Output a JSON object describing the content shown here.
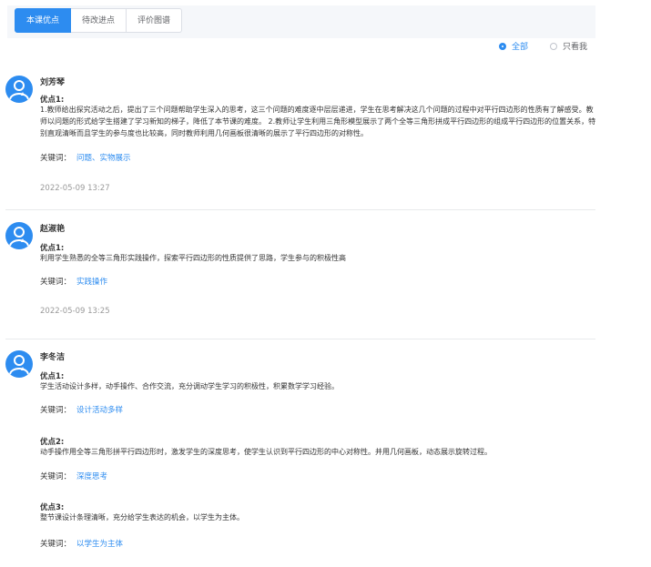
{
  "tabs": [
    "本课优点",
    "待改进点",
    "评价图谱"
  ],
  "filters": {
    "all": "全部",
    "mine": "只看我"
  },
  "comments": [
    {
      "name": "刘芳琴",
      "points": [
        {
          "title": "优点1:",
          "text": "1.教师给出探究活动之后，提出了三个问题帮助学生深入的思考，这三个问题的难度逐中层层递进，学生在思考解决这几个问题的过程中对平行四边形的性质有了解感受。教师以问题的形式给学生搭建了学习新知的梯子，降低了本节课的难度。 2.教师让学生利用三角形模型展示了两个全等三角形拼成平行四边形的组成平行四边形的位置关系，特别直观清晰而且学生的参与度也比较高，同时教师利用几何画板很清晰的展示了平行四边形的对称性。",
          "keyword_label": "关键词：",
          "keywords": "问题、实物展示"
        }
      ],
      "time": "2022-05-09 13:27"
    },
    {
      "name": "赵淑艳",
      "points": [
        {
          "title": "优点1:",
          "text": "利用学生熟悉的全等三角形实践操作，探索平行四边形的性质提供了思路，学生参与的积极性高",
          "keyword_label": "关键词：",
          "keywords": "实践操作"
        }
      ],
      "time": "2022-05-09 13:25"
    },
    {
      "name": "李冬洁",
      "points": [
        {
          "title": "优点1:",
          "text": "学生活动设计多样，动手操作、合作交流，充分调动学生学习的积极性，积累数学学习经验。",
          "keyword_label": "关键词：",
          "keywords": "设计活动多样"
        },
        {
          "title": "优点2:",
          "text": "动手操作用全等三角形拼平行四边形时，激发学生的深度思考，使学生认识到平行四边形的中心对称性。并用几何画板，动态展示旋转过程。",
          "keyword_label": "关键词：",
          "keywords": "深度思考"
        },
        {
          "title": "优点3:",
          "text": "整节课设计条理清晰，充分给学生表达的机会，以学生为主体。",
          "keyword_label": "关键词：",
          "keywords": "以学生为主体"
        }
      ],
      "time": ""
    }
  ]
}
